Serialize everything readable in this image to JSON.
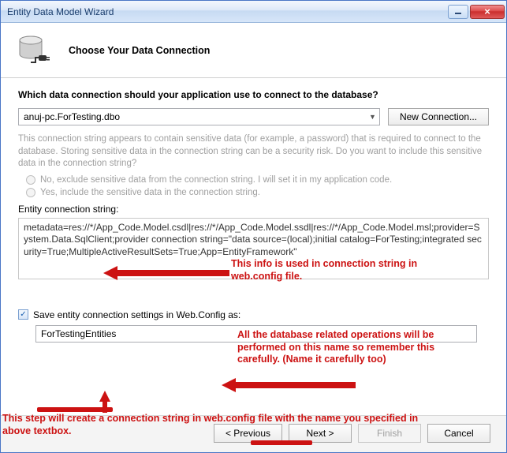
{
  "window": {
    "title": "Entity Data Model Wizard",
    "minimize": "–",
    "close": "×"
  },
  "header": {
    "title": "Choose Your Data Connection"
  },
  "question": "Which data connection should your application use to connect to the database?",
  "connection": {
    "selected": "anuj-pc.ForTesting.dbo",
    "new_btn": "New Connection..."
  },
  "warning": "This connection string appears to contain sensitive data (for example, a password) that is required to connect to the database. Storing sensitive data in the connection string can be a security risk. Do you want to include this sensitive data in the connection string?",
  "radios": {
    "exclude": "No, exclude sensitive data from the connection string. I will set it in my application code.",
    "include": "Yes, include the sensitive data in the connection string."
  },
  "ecs_label": "Entity connection string:",
  "conn_string": "metadata=res://*/App_Code.Model.csdl|res://*/App_Code.Model.ssdl|res://*/App_Code.Model.msl;provider=System.Data.SqlClient;provider connection string=\"data source=(local);initial catalog=ForTesting;integrated security=True;MultipleActiveResultSets=True;App=EntityFramework\"",
  "save_checkbox_label": "Save entity connection settings in Web.Config as:",
  "entity_name": "ForTestingEntities",
  "buttons": {
    "previous": "< Previous",
    "next": "Next >",
    "finish": "Finish",
    "cancel": "Cancel"
  },
  "anno": {
    "a1": "This info is used in connection string in web.config file.",
    "a2": "All the database related operations will be performed on this name so remember this carefully. (Name it carefully too)",
    "a3": "This step will create a connection string in web.config file with the name you specified in above textbox."
  }
}
